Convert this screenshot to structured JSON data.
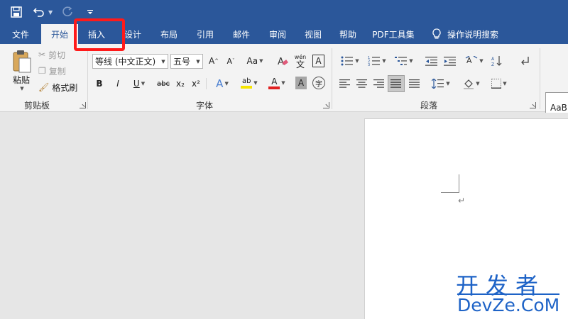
{
  "qat": {
    "save_icon": "save-icon",
    "undo_icon": "undo-icon",
    "redo_icon": "redo-icon",
    "customize_icon": "customize-qat-icon"
  },
  "tabs": [
    {
      "label": "文件",
      "active": false
    },
    {
      "label": "开始",
      "active": true
    },
    {
      "label": "插入",
      "active": false
    },
    {
      "label": "设计",
      "active": false
    },
    {
      "label": "布局",
      "active": false
    },
    {
      "label": "引用",
      "active": false
    },
    {
      "label": "邮件",
      "active": false
    },
    {
      "label": "审阅",
      "active": false
    },
    {
      "label": "视图",
      "active": false
    },
    {
      "label": "帮助",
      "active": false
    },
    {
      "label": "PDF工具集",
      "active": false
    }
  ],
  "tell_me": {
    "label": "操作说明搜索",
    "icon": "lightbulb-icon"
  },
  "clipboard": {
    "group_label": "剪贴板",
    "paste_label": "粘贴",
    "cut_label": "剪切",
    "copy_label": "复制",
    "format_painter_label": "格式刷"
  },
  "font": {
    "group_label": "字体",
    "font_name": "等线 (中文正文)",
    "font_size": "五号",
    "grow": "A",
    "shrink": "A",
    "case": "Aa",
    "pinyin_top": "wén",
    "pinyin_bottom": "文",
    "border_char": "A",
    "bold": "B",
    "italic": "I",
    "underline": "U",
    "strike": "abc",
    "sub": "x₂",
    "sup": "x²",
    "effects": "A",
    "highlight": "ab",
    "color": "A",
    "shading": "A",
    "enclose": "字"
  },
  "paragraph": {
    "group_label": "段落"
  },
  "styles": {
    "preview": "AaB"
  },
  "document": {
    "para_mark": "↵"
  },
  "watermark": {
    "chinese": "开发者",
    "english": "DevZe.CoM"
  },
  "colors": {
    "ribbon_blue": "#2b579a",
    "highlight_red": "#ff1a1a",
    "watermark_blue": "#1e63c7",
    "font_color_red": "#e02020",
    "highlight_yellow": "#f5e400"
  }
}
